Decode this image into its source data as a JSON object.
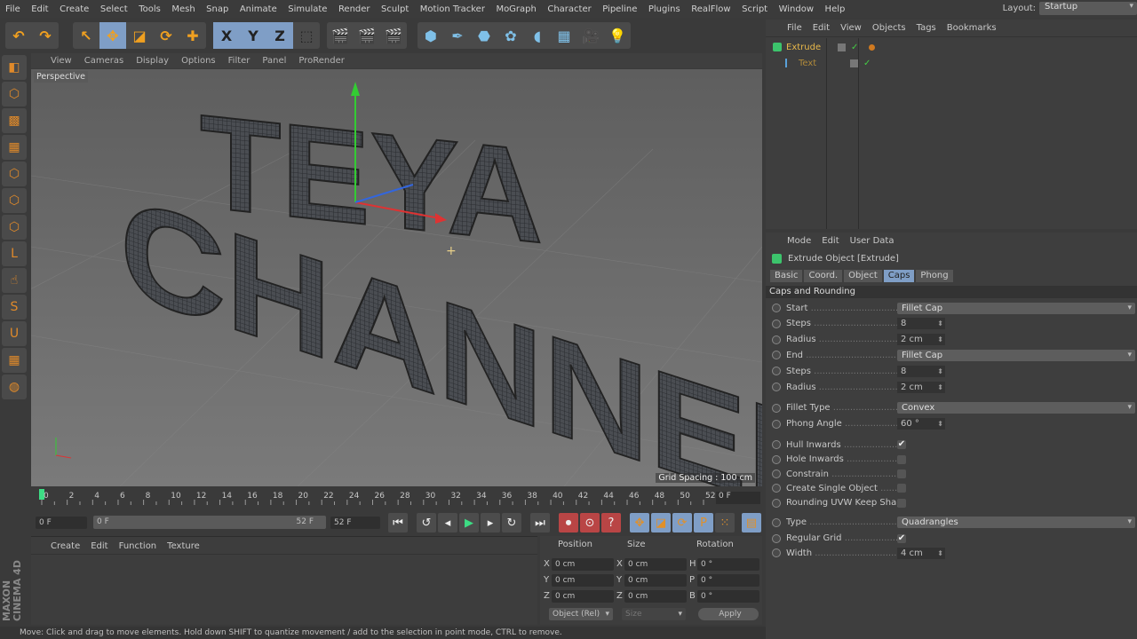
{
  "menubar": {
    "items": [
      "File",
      "Edit",
      "Create",
      "Select",
      "Tools",
      "Mesh",
      "Snap",
      "Animate",
      "Simulate",
      "Render",
      "Sculpt",
      "Motion Tracker",
      "MoGraph",
      "Character",
      "Pipeline",
      "Plugins",
      "RealFlow",
      "Script",
      "Window",
      "Help"
    ],
    "layout_label": "Layout:",
    "layout_value": "Startup"
  },
  "toolbar": {
    "groups": [
      [
        {
          "icon": "undo-icon",
          "g": "↶"
        },
        {
          "icon": "redo-icon",
          "g": "↷"
        }
      ],
      [
        {
          "icon": "live-selection-icon",
          "g": "↖"
        },
        {
          "icon": "move-icon",
          "g": "✥",
          "on": true
        },
        {
          "icon": "scale-icon",
          "g": "◪"
        },
        {
          "icon": "rotate-icon",
          "g": "⟳"
        },
        {
          "icon": "recent-tool-icon",
          "g": "✚"
        }
      ],
      [
        {
          "icon": "x-axis-icon",
          "g": "X",
          "on": true
        },
        {
          "icon": "y-axis-icon",
          "g": "Y",
          "on": true
        },
        {
          "icon": "z-axis-icon",
          "g": "Z",
          "on": true
        },
        {
          "icon": "coordinate-system-icon",
          "g": "⬚"
        }
      ],
      [
        {
          "icon": "render-view-icon",
          "g": "🎬"
        },
        {
          "icon": "render-picture-viewer-icon",
          "g": "🎬"
        },
        {
          "icon": "render-settings-icon",
          "g": "🎬"
        }
      ],
      [
        {
          "icon": "cube-icon",
          "g": "⬢"
        },
        {
          "icon": "pen-spline-icon",
          "g": "✒"
        },
        {
          "icon": "subdivision-surface-icon",
          "g": "⬣"
        },
        {
          "icon": "cloner-icon",
          "g": "✿"
        },
        {
          "icon": "deformer-icon",
          "g": "◖"
        },
        {
          "icon": "floor-icon",
          "g": "▦"
        },
        {
          "icon": "camera-icon",
          "g": "🎥"
        },
        {
          "icon": "light-icon",
          "g": "💡"
        }
      ]
    ]
  },
  "left_toolbar": [
    {
      "icon": "make-editable-icon",
      "g": "◧"
    },
    {
      "icon": "model-mode-icon",
      "g": "⬡"
    },
    {
      "icon": "texture-mode-icon",
      "g": "▩"
    },
    {
      "icon": "workplane-icon",
      "g": "▦"
    },
    {
      "icon": "points-mode-icon",
      "g": "⬡"
    },
    {
      "icon": "edges-mode-icon",
      "g": "⬡"
    },
    {
      "icon": "polygons-mode-icon",
      "g": "⬡"
    },
    {
      "icon": "axis-mode-icon",
      "g": "L"
    },
    {
      "icon": "tweak-mode-icon",
      "g": "☝"
    },
    {
      "icon": "snapping-icon",
      "g": "S"
    },
    {
      "icon": "magnet-icon",
      "g": "U"
    },
    {
      "icon": "workplane-lock-icon",
      "g": "▦"
    },
    {
      "icon": "solo-icon",
      "g": "◍"
    }
  ],
  "viewport": {
    "menu": [
      "View",
      "Cameras",
      "Display",
      "Options",
      "Filter",
      "Panel",
      "ProRender"
    ],
    "camera_label": "Perspective",
    "grid_spacing": "Grid Spacing : 100 cm",
    "text_line1": "TEYA",
    "text_line2": "CHANNEL"
  },
  "timeline": {
    "ticks": [
      0,
      2,
      4,
      6,
      8,
      10,
      12,
      14,
      16,
      18,
      20,
      22,
      24,
      26,
      28,
      30,
      32,
      34,
      36,
      38,
      40,
      42,
      44,
      46,
      48,
      50,
      52
    ],
    "current_frame": "0 F",
    "start_field": "0 F",
    "range_start": "0 F",
    "range_end": "52 F",
    "end_field": "52 F"
  },
  "playback": [
    {
      "icon": "go-to-start-icon",
      "g": "⏮"
    },
    {
      "icon": "previous-key-icon",
      "g": "↺"
    },
    {
      "icon": "previous-frame-icon",
      "g": "◂"
    },
    {
      "icon": "play-icon",
      "g": "▶"
    },
    {
      "icon": "next-frame-icon",
      "g": "▸"
    },
    {
      "icon": "next-key-icon",
      "g": "↻"
    },
    {
      "icon": "go-to-end-icon",
      "g": "⏭"
    },
    {
      "icon": "record-icon",
      "g": "⏺"
    },
    {
      "icon": "autokey-icon",
      "g": "⊙"
    },
    {
      "icon": "keyframe-selection-icon",
      "g": "?"
    },
    {
      "icon": "key-position-icon",
      "g": "✥"
    },
    {
      "icon": "key-scale-icon",
      "g": "◪"
    },
    {
      "icon": "key-rotation-icon",
      "g": "⟳"
    },
    {
      "icon": "key-parameter-icon",
      "g": "P"
    },
    {
      "icon": "key-pla-icon",
      "g": "⁙"
    },
    {
      "icon": "timeline-icon",
      "g": "▤"
    }
  ],
  "material_manager": {
    "menu": [
      "Create",
      "Edit",
      "Function",
      "Texture"
    ]
  },
  "coordinates": {
    "headers": [
      "Position",
      "Size",
      "Rotation"
    ],
    "rows": [
      {
        "pl": "X",
        "pv": "0 cm",
        "sl": "X",
        "sv": "0 cm",
        "rl": "H",
        "rv": "0 °"
      },
      {
        "pl": "Y",
        "pv": "0 cm",
        "sl": "Y",
        "sv": "0 cm",
        "rl": "P",
        "rv": "0 °"
      },
      {
        "pl": "Z",
        "pv": "0 cm",
        "sl": "Z",
        "sv": "0 cm",
        "rl": "B",
        "rv": "0 °"
      }
    ],
    "mode": "Object (Rel)",
    "size_mode": "Size",
    "apply": "Apply"
  },
  "branding": "MAXON CINEMA 4D",
  "status": "Move: Click and drag to move elements. Hold down SHIFT to quantize movement / add to the selection in point mode, CTRL to remove.",
  "object_manager": {
    "menu": [
      "File",
      "Edit",
      "View",
      "Objects",
      "Tags",
      "Bookmarks"
    ],
    "objects": [
      {
        "name": "Extrude",
        "color": "#e8b84a"
      },
      {
        "name": "Text",
        "color": "#b08a3a"
      }
    ]
  },
  "attributes": {
    "menu": [
      "Mode",
      "Edit",
      "User Data"
    ],
    "title": "Extrude Object [Extrude]",
    "tabs": [
      "Basic",
      "Coord.",
      "Object",
      "Caps",
      "Phong"
    ],
    "active_tab": "Caps",
    "section": "Caps and Rounding",
    "rows": [
      {
        "label": "Start",
        "type": "dd",
        "value": "Fillet Cap"
      },
      {
        "label": "Steps",
        "type": "num",
        "value": "8"
      },
      {
        "label": "Radius",
        "type": "num",
        "value": "2 cm"
      },
      {
        "label": "End",
        "type": "dd",
        "value": "Fillet Cap"
      },
      {
        "label": "Steps",
        "type": "num",
        "value": "8"
      },
      {
        "label": "Radius",
        "type": "num",
        "value": "2 cm"
      },
      {
        "label": "Fillet Type",
        "type": "dd",
        "value": "Convex",
        "gap": true
      },
      {
        "label": "Phong Angle",
        "type": "num",
        "value": "60 °"
      },
      {
        "label": "Hull Inwards",
        "type": "chk",
        "value": true,
        "gap": true
      },
      {
        "label": "Hole Inwards",
        "type": "chk",
        "value": false
      },
      {
        "label": "Constrain",
        "type": "chk",
        "value": false
      },
      {
        "label": "Create Single Object",
        "type": "chk",
        "value": false
      },
      {
        "label": "Rounding UVW Keep Shape",
        "type": "chk",
        "value": false
      },
      {
        "label": "Type",
        "type": "dd",
        "value": "Quadrangles",
        "gap": true
      },
      {
        "label": "Regular Grid",
        "type": "chk",
        "value": true
      },
      {
        "label": "Width",
        "type": "num",
        "value": "4 cm"
      }
    ]
  },
  "colors": {
    "accent": "#7f9ec6",
    "keyframe": "#3ddc84"
  }
}
